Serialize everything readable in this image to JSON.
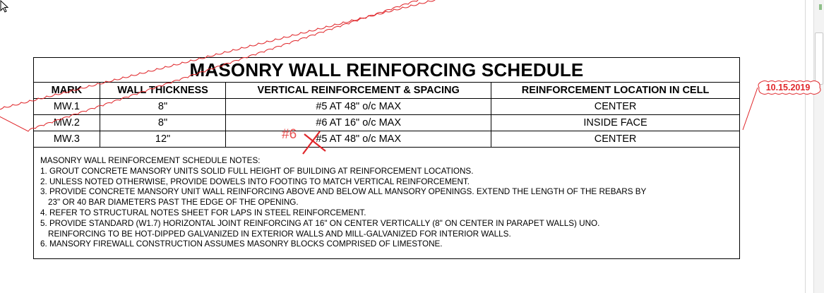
{
  "schedule": {
    "title": "MASONRY WALL REINFORCING SCHEDULE",
    "columns": [
      "MARK",
      "WALL THICKNESS",
      "VERTICAL REINFORCEMENT & SPACING",
      "REINFORCEMENT LOCATION IN CELL"
    ],
    "rows": [
      [
        "MW.1",
        "8\"",
        "#5 AT 48\" o/c MAX",
        "CENTER"
      ],
      [
        "MW.2",
        "8\"",
        "#6 AT 16\" o/c MAX",
        "INSIDE FACE"
      ],
      [
        "MW.3",
        "12\"",
        "#5 AT 48\" o/c MAX",
        "CENTER"
      ]
    ]
  },
  "notes": {
    "heading": "MASONRY WALL REINFORCEMENT SCHEDULE NOTES:",
    "lines": [
      "1. GROUT CONCRETE MANSORY UNITS SOLID FULL HEIGHT OF BUILDING AT REINFORCEMENT LOCATIONS.",
      "2. UNLESS NOTED OTHERWISE, PROVIDE DOWELS INTO FOOTING TO MATCH VERTICAL REINFORCEMENT.",
      "3. PROVIDE CONCRETE MANSORY UNIT WALL REINFORCING ABOVE AND BELOW ALL MANSORY OPENINGS. EXTEND THE LENGTH OF THE REBARS BY",
      "23\" OR 40 BAR DIAMETERS PAST THE EDGE OF THE OPENING.",
      "4. REFER TO STRUCTURAL NOTES SHEET FOR LAPS IN STEEL REINFORCEMENT.",
      "5. PROVIDE STANDARD (W1.7) HORIZONTAL JOINT REINFORCING AT 16\" ON CENTER VERTICALLY (8\" ON CENTER IN PARAPET WALLS) UNO.",
      "REINFORCING TO BE HOT-DIPPED GALVANIZED IN EXTERIOR WALLS AND MILL-GALVANIZED FOR INTERIOR WALLS.",
      "6. MANSORY FIREWALL CONSTRUCTION ASSUMES MASONRY BLOCKS COMPRISED OF LIMESTONE."
    ]
  },
  "markup": {
    "revision_date": "10.15.2019",
    "replacement_text": "#6",
    "color": "#e0262a"
  }
}
